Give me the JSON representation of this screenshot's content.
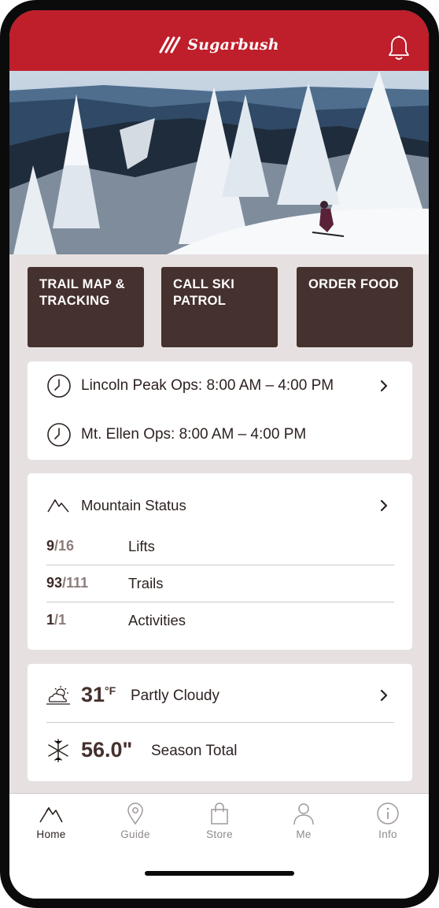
{
  "header": {
    "brand": "Sugarbush",
    "colors": {
      "brand_red": "#bf1e2b",
      "tile_brown": "#45312d"
    },
    "icons": {
      "logo": "sugarbush-logo-icon",
      "notifications": "bell-icon"
    }
  },
  "actions": [
    {
      "line1": "TRAIL MAP &",
      "line2": "TRACKING"
    },
    {
      "line1": "CALL SKI",
      "line2": "PATROL"
    },
    {
      "line1": "ORDER FOOD",
      "line2": ""
    }
  ],
  "operations": {
    "lincoln": "Lincoln Peak Ops: 8:00 AM – 4:00 PM",
    "ellen": "Mt. Ellen Ops: 8:00 AM – 4:00 PM"
  },
  "mountain_status": {
    "title": "Mountain Status",
    "stats": [
      {
        "open": "9",
        "total": "/16",
        "label": "Lifts"
      },
      {
        "open": "93",
        "total": "/111",
        "label": "Trails"
      },
      {
        "open": "1",
        "total": "/1",
        "label": "Activities"
      }
    ]
  },
  "weather": {
    "temp": "31",
    "unit": "°F",
    "condition": "Partly Cloudy",
    "snow": "56.0\"",
    "snow_label": "Season Total"
  },
  "nav": [
    {
      "label": "Home",
      "icon": "mountain-icon",
      "active": true
    },
    {
      "label": "Guide",
      "icon": "map-pin-icon",
      "active": false
    },
    {
      "label": "Store",
      "icon": "shopping-bag-icon",
      "active": false
    },
    {
      "label": "Me",
      "icon": "person-icon",
      "active": false
    },
    {
      "label": "Info",
      "icon": "info-icon",
      "active": false
    }
  ]
}
